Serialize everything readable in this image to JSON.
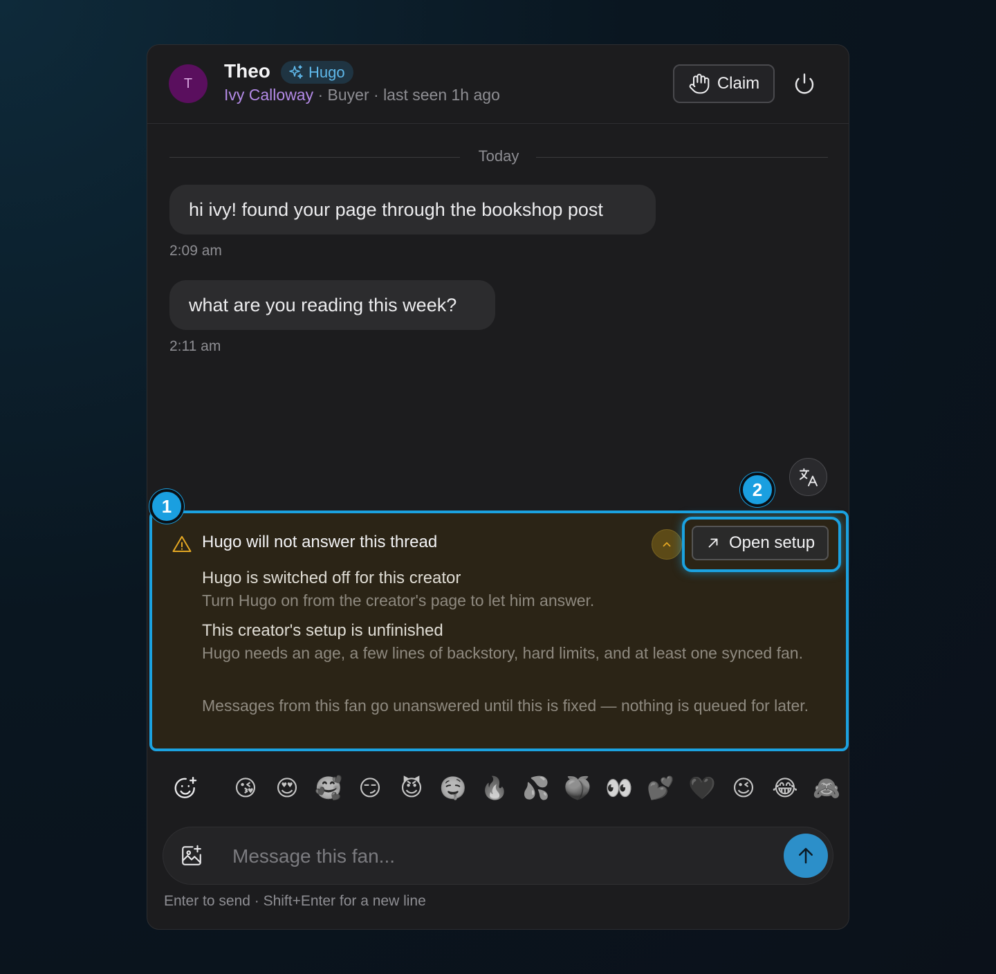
{
  "header": {
    "avatar_initial": "T",
    "fan_name": "Theo",
    "agent_badge": "Hugo",
    "creator_name": "Ivy Calloway",
    "meta": " · Buyer · last seen 1h ago",
    "claim_label": "Claim"
  },
  "thread": {
    "date_divider": "Today",
    "messages": [
      {
        "text": "hi ivy! found your page through the bookshop post",
        "time": "2:09 am"
      },
      {
        "text": "what are you reading this week?",
        "time": "2:11 am"
      }
    ]
  },
  "alert": {
    "title": "Hugo will not answer this thread",
    "action_label": "Open setup",
    "items": [
      {
        "title": "Hugo is switched off for this creator",
        "desc": "Turn Hugo on from the creator's page to let him answer."
      },
      {
        "title": "This creator's setup is unfinished",
        "desc": "Hugo needs an age, a few lines of backstory, hard limits, and at least one synced fan."
      }
    ],
    "note": "Messages from this fan go unanswered until this is fixed — nothing is queued for later."
  },
  "markers": [
    "1",
    "2"
  ],
  "emojis": [
    "😘",
    "😍",
    "🥰",
    "😏",
    "😈",
    "🤤",
    "🔥",
    "💦",
    "🍑",
    "👀",
    "💕",
    "🖤",
    "😉",
    "😂",
    "🙈"
  ],
  "composer": {
    "placeholder": "Message this fan...",
    "hint": "Enter to send · Shift+Enter for a new line"
  },
  "colors": {
    "accent": "#1ba2e0",
    "creator_name": "#b38ae6",
    "agent_badge": "#5fb8ea",
    "alert_bg": "#2b2416",
    "warning": "#e5a823",
    "send_button": "#2c8fc9"
  },
  "icons": [
    "sparkles-icon",
    "hand-icon",
    "power-icon",
    "translate-icon",
    "warning-icon",
    "chevron-up-icon",
    "arrow-up-right-icon",
    "emoji-add-icon",
    "image-add-icon",
    "arrow-up-icon"
  ]
}
